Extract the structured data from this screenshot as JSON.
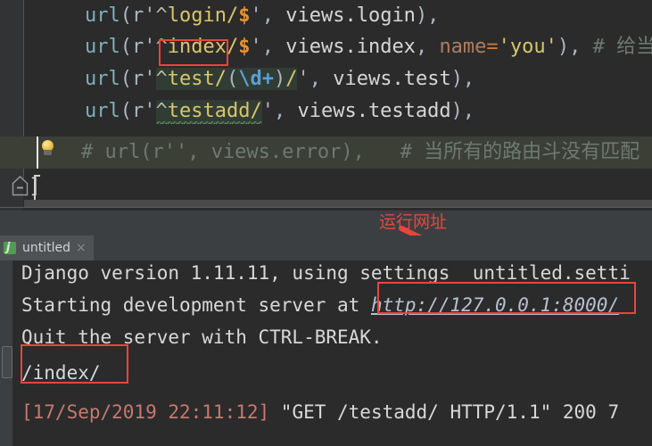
{
  "editor": {
    "name": "pycharm-code-editor",
    "lines": [
      {
        "id": "line-login",
        "fn": "url",
        "open": "(r'",
        "anchor": "^",
        "path": "login/",
        "dollar": "$",
        "close": "', ",
        "view": "views.login",
        "tail": "),"
      },
      {
        "id": "line-index",
        "fn": "url",
        "open": "(r'",
        "anchor": "^",
        "path": "index/",
        "dollar": "$",
        "close": "', ",
        "view": "views.index",
        "sep": ", ",
        "kwarg": "name",
        "eq": "=",
        "kwval": "'you'",
        "tail": "), ",
        "comment": "# 给当前"
      },
      {
        "id": "line-test",
        "fn": "url",
        "open": "(r'",
        "anchor": "^",
        "path": "test/",
        "group_open": "(",
        "escape": "\\d",
        "plus": "+",
        "group_close": ")",
        "slash": "/",
        "close": "', ",
        "view": "views.test",
        "tail": "),"
      },
      {
        "id": "line-testadd",
        "fn": "url",
        "open": "(r'",
        "anchor": "^",
        "path": "testadd/",
        "close": "', ",
        "view": "views.testadd",
        "tail": "),"
      }
    ],
    "commented_line": {
      "id": "line-commented-error",
      "text": "# url(r'', views.error),   # 当所有的路由斗没有匹配"
    },
    "closing_bracket": "]"
  },
  "annotation": {
    "label": "运行网址",
    "color": "#e8453c",
    "boxes": [
      "index-route-box",
      "server-url-box",
      "index-request-box"
    ]
  },
  "console": {
    "tab": {
      "label": "untitled",
      "close": "×",
      "icon_letter": "j"
    },
    "lines": [
      {
        "id": "console-line-version",
        "text": "Django version 1.11.11, using settings  untitled.setti"
      },
      {
        "id": "console-line-starting",
        "prefix": "Starting development server at ",
        "url": "http://127.0.0.1:8000/"
      },
      {
        "id": "console-line-quit",
        "text": "Quit the server with CTRL-BREAK."
      },
      {
        "id": "console-line-index",
        "text": "/index/"
      },
      {
        "id": "console-line-request",
        "timestamp": "[17/Sep/2019 22:11:12]",
        "request": " \"GET /testadd/ HTTP/1.1\" 200 7"
      }
    ]
  }
}
